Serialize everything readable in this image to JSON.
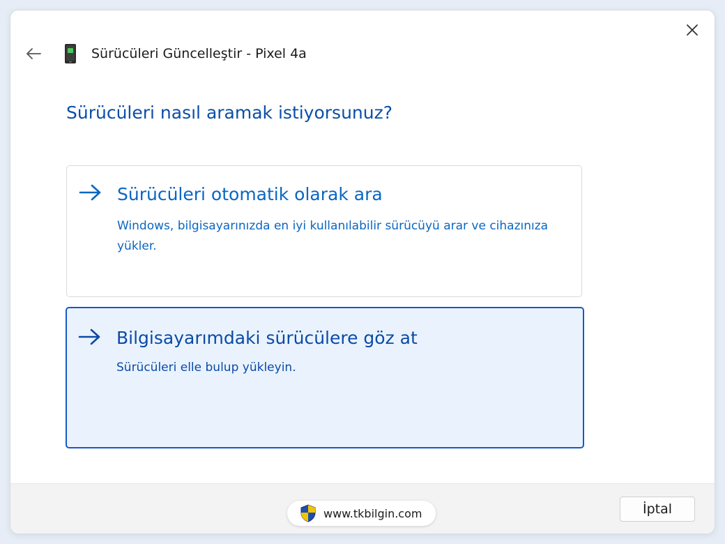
{
  "window": {
    "title": "Sürücüleri Güncelleştir - Pixel 4a",
    "back_icon": "back-arrow-icon",
    "close_icon": "close-icon",
    "device_icon": "phone-device-icon"
  },
  "main": {
    "question": "Sürücüleri nasıl aramak istiyorsunuz?",
    "options": [
      {
        "title": "Sürücüleri otomatik olarak ara",
        "description": "Windows, bilgisayarınızda en iyi kullanılabilir sürücüyü arar ve cihazınıza yükler.",
        "icon": "arrow-right-icon",
        "selected": false
      },
      {
        "title": "Bilgisayarımdaki sürücülere göz at",
        "description": "Sürücüleri elle bulup yükleyin.",
        "icon": "arrow-right-icon",
        "selected": true
      }
    ]
  },
  "footer": {
    "watermark": "www.tkbilgin.com",
    "watermark_icon": "uac-shield-icon",
    "cancel_label": "İptal"
  },
  "colors": {
    "accent": "#0a66c2",
    "selected_border": "#1559c4",
    "selected_background": "#eaf3fd",
    "heading": "#0b4fa8"
  }
}
